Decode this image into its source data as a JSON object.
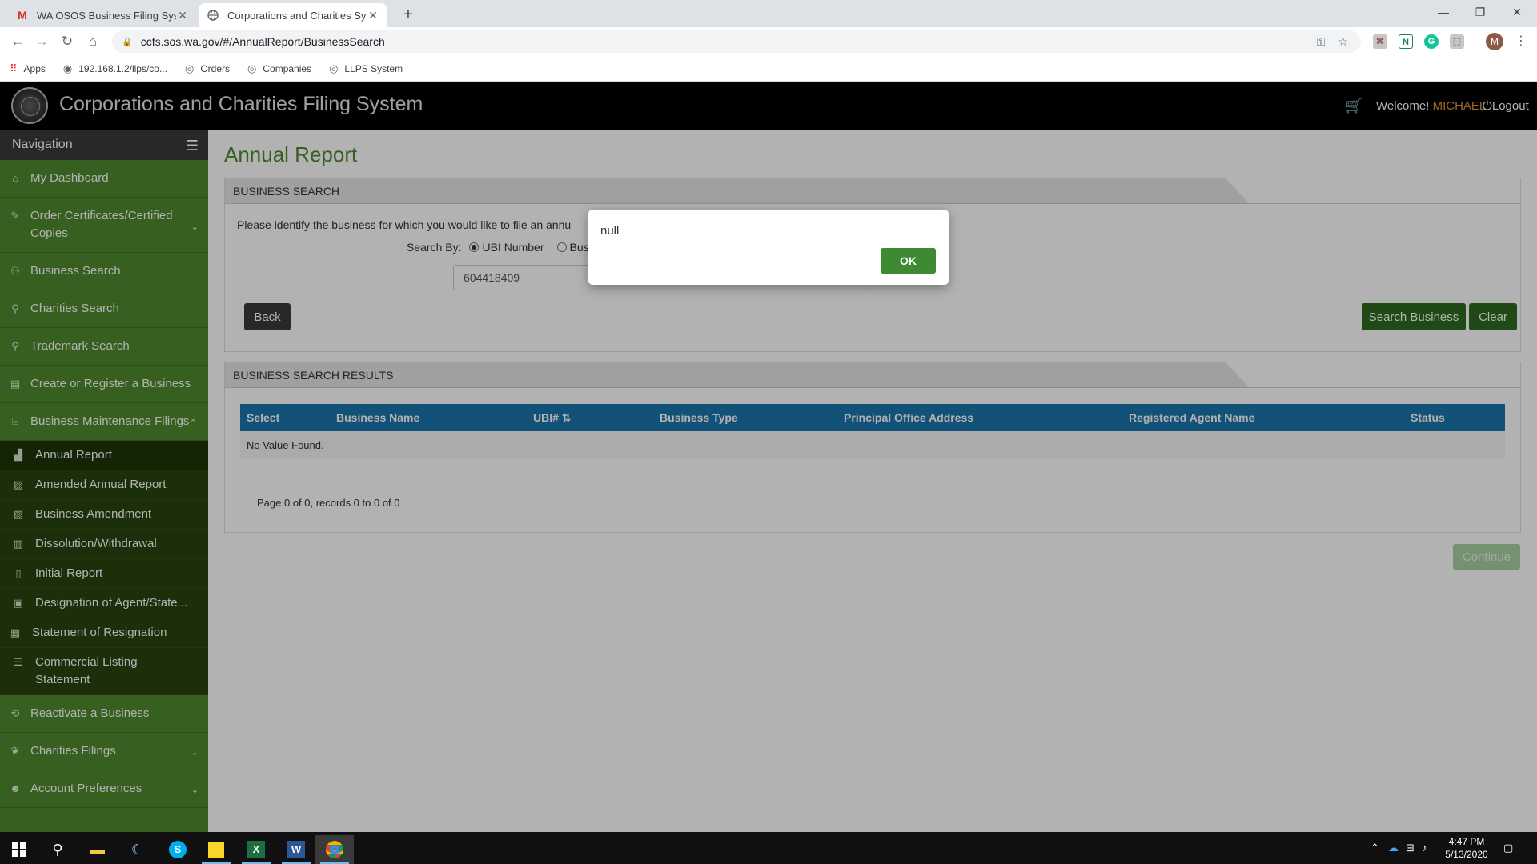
{
  "browser": {
    "tabs": [
      {
        "title": "WA OSOS Business Filing System",
        "icon": "gmail-icon"
      },
      {
        "title": "Corporations and Charities Syste",
        "icon": "globe-icon"
      }
    ],
    "url": "ccfs.sos.wa.gov/#/AnnualReport/BusinessSearch",
    "bookmarks": [
      "Apps",
      "192.168.1.2/llps/co...",
      "Orders",
      "Companies",
      "LLPS System"
    ],
    "profile_initial": "M"
  },
  "header": {
    "title": "Corporations and Charities Filing System",
    "welcome": "Welcome!",
    "username": "MICHAEL",
    "logout": "Logout"
  },
  "sidebar": {
    "heading": "Navigation",
    "items": [
      {
        "label": "My Dashboard",
        "icon": "home-icon"
      },
      {
        "label": "Order Certificates/Certified Copies",
        "icon": "certificate-icon"
      },
      {
        "label": "Business Search",
        "icon": "binoculars-icon"
      },
      {
        "label": "Charities Search",
        "icon": "search-icon"
      },
      {
        "label": "Trademark Search",
        "icon": "search-icon"
      },
      {
        "label": "Create or Register a Business",
        "icon": "document-icon"
      },
      {
        "label": "Business Maintenance Filings",
        "icon": "building-icon"
      },
      {
        "label": "Reactivate a Business",
        "icon": "refresh-icon"
      },
      {
        "label": "Charities Filings",
        "icon": "handshake-icon"
      },
      {
        "label": "Account Preferences",
        "icon": "user-icon"
      }
    ],
    "subitems": [
      {
        "label": "Annual Report",
        "icon": "bar-chart-icon"
      },
      {
        "label": "Amended Annual Report",
        "icon": "chart-edit-icon"
      },
      {
        "label": "Business Amendment",
        "icon": "document-edit-icon"
      },
      {
        "label": "Dissolution/Withdrawal",
        "icon": "document-icon"
      },
      {
        "label": "Initial Report",
        "icon": "file-icon"
      },
      {
        "label": "Designation of Agent/State...",
        "icon": "agent-icon"
      },
      {
        "label": "Statement of Resignation",
        "icon": "statement-icon"
      },
      {
        "label": "Commercial Listing Statement",
        "icon": "list-icon"
      }
    ]
  },
  "page": {
    "title": "Annual Report",
    "search": {
      "heading": "BUSINESS SEARCH",
      "instruction": "Please identify the business for which you would like to file an annu",
      "search_by_label": "Search By:",
      "option_ubi": "UBI Number",
      "option_business": "Busine",
      "ubi_value": "604418409",
      "back": "Back",
      "search_business": "Search Business",
      "clear": "Clear"
    },
    "results": {
      "heading": "BUSINESS SEARCH RESULTS",
      "columns": [
        "Select",
        "Business Name",
        "UBI#",
        "Business Type",
        "Principal Office Address",
        "Registered Agent Name",
        "Status"
      ],
      "empty": "No Value Found.",
      "pager": "Page 0 of 0, records 0 to 0 of 0"
    },
    "continue": "Continue"
  },
  "dialog": {
    "message": "null",
    "ok": "OK"
  },
  "taskbar": {
    "time": "4:47 PM",
    "date": "5/13/2020"
  },
  "colors": {
    "sidebar_green": "#4f8a2e",
    "sidebar_sub": "#27440f",
    "table_header_blue": "#1b75ad",
    "button_green": "#2e6b1f",
    "username_orange": "#e8933a"
  }
}
